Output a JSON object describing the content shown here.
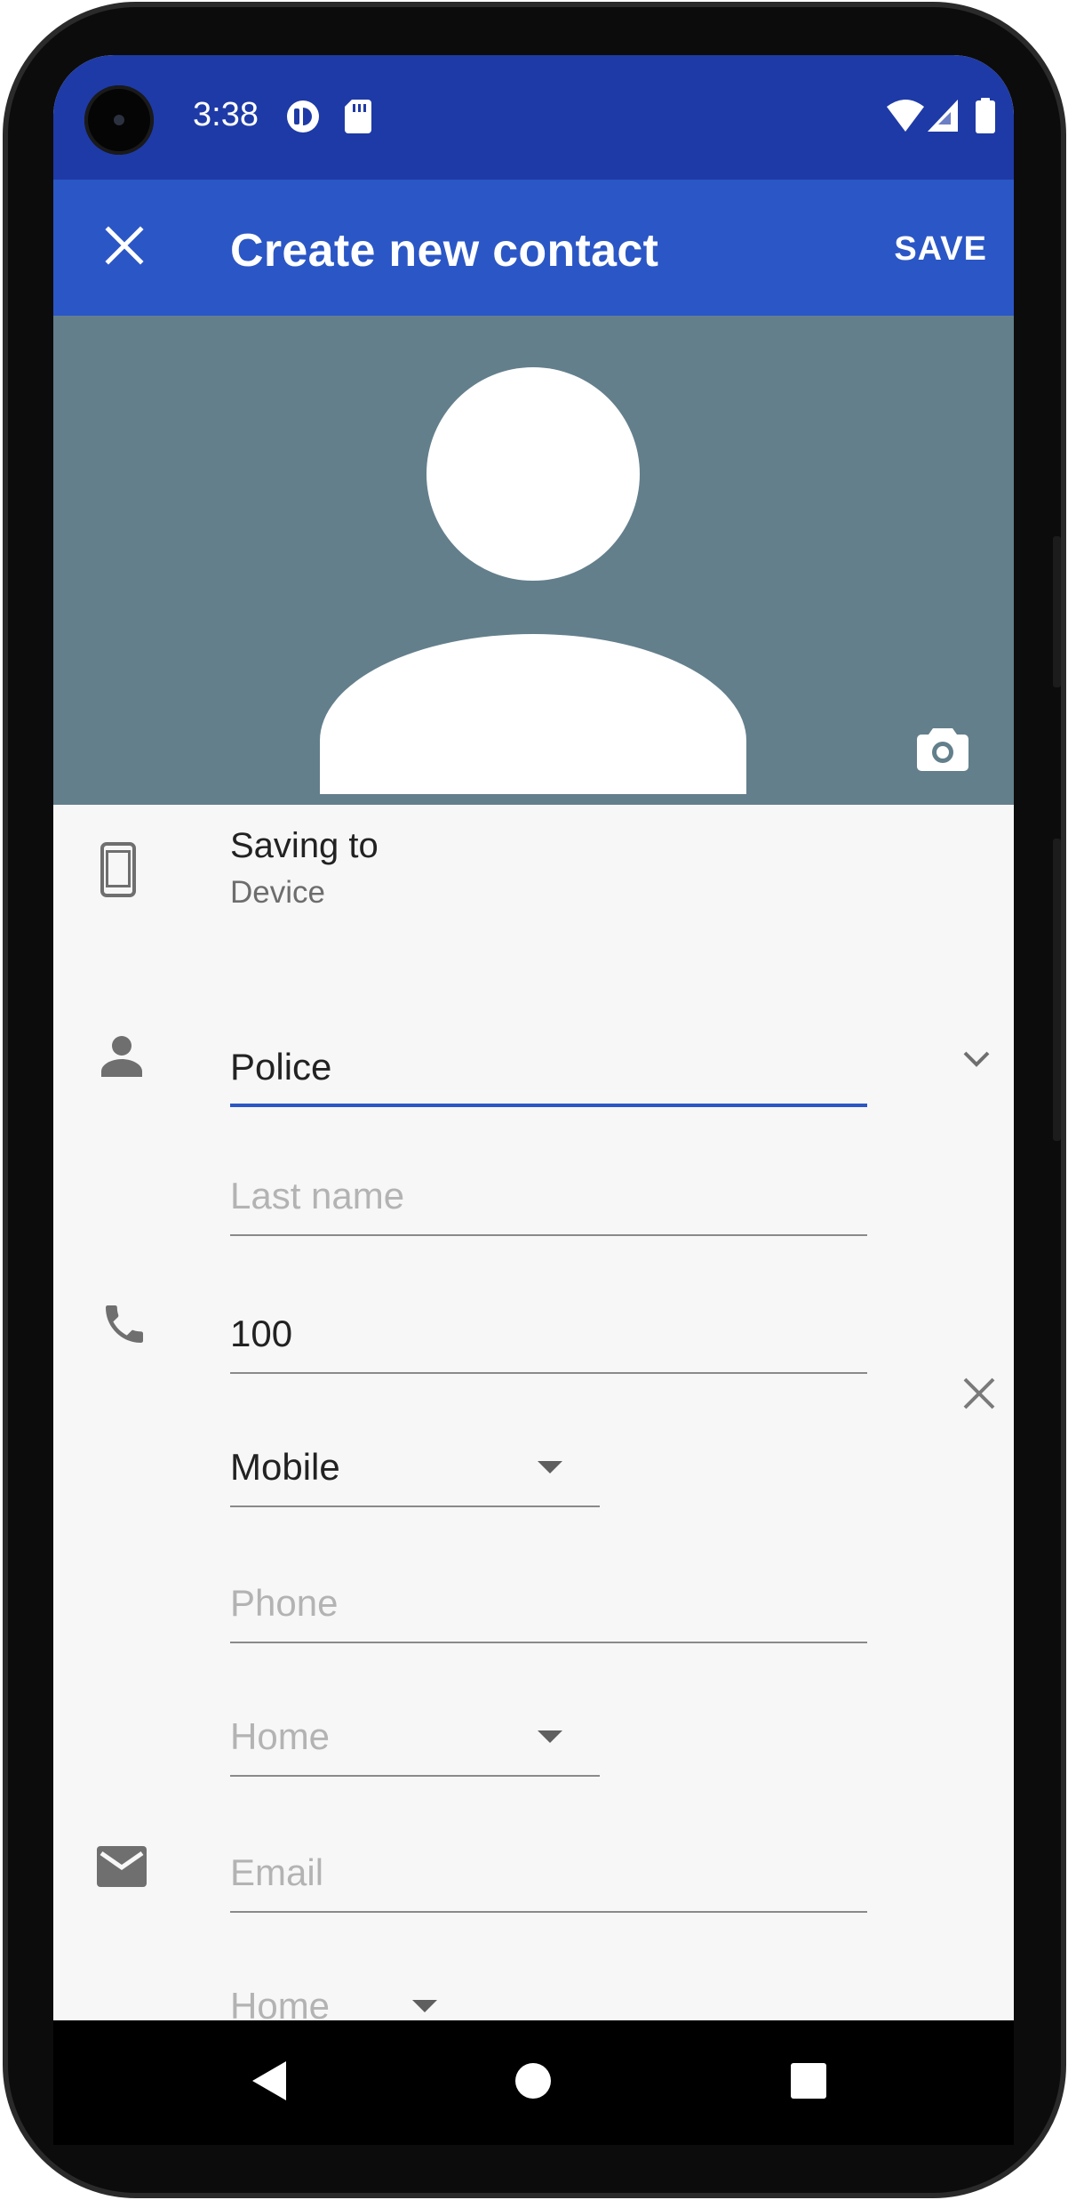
{
  "status_bar": {
    "time": "3:38",
    "left_icons": [
      "data-saver-icon",
      "sd-card-icon"
    ],
    "right_icons": [
      "wifi-icon",
      "cell-signal-icon",
      "battery-icon"
    ]
  },
  "app_bar": {
    "title": "Create new contact",
    "save_label": "SAVE",
    "close_icon": "close-icon"
  },
  "photo": {
    "camera_icon": "camera-icon"
  },
  "account": {
    "label": "Saving to",
    "value": "Device",
    "icon": "smartphone-icon"
  },
  "name": {
    "first_name_value": "Police",
    "last_name_placeholder": "Last name",
    "icon": "person-icon",
    "expand_icon": "chevron-down-icon"
  },
  "phone": {
    "icon": "phone-icon",
    "entries": [
      {
        "value": "100",
        "type": "Mobile"
      },
      {
        "placeholder": "Phone",
        "type_placeholder": "Home"
      }
    ],
    "remove_icon": "close-icon"
  },
  "email": {
    "icon": "email-icon",
    "placeholder": "Email",
    "type_placeholder": "Home"
  },
  "navigation": {
    "buttons": [
      "back-icon",
      "home-icon",
      "recents-icon"
    ]
  },
  "colors": {
    "status_bar": "#1e3aa6",
    "app_bar": "#2b56c5",
    "photo_background": "#637f8c",
    "form_background": "#f7f7f7",
    "focus_underline": "#2b56c5"
  }
}
